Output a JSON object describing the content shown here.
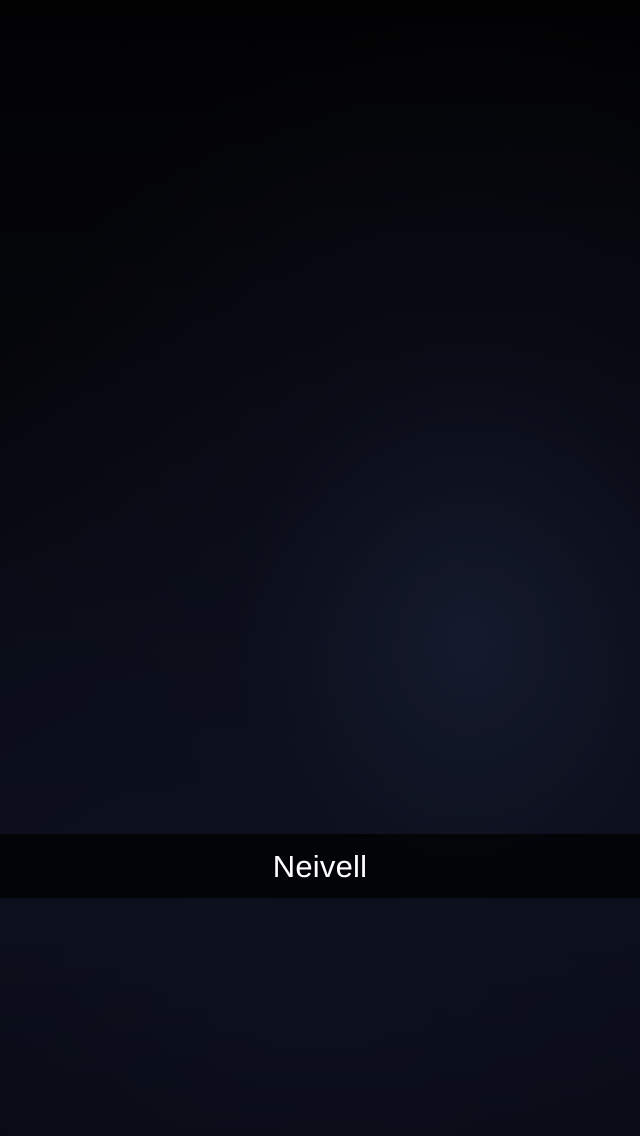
{
  "snap": {
    "caption": "Neivell"
  },
  "colors": {
    "background_dark": "#05060a",
    "caption_bar": "#000000",
    "caption_text": "#ffffff"
  }
}
